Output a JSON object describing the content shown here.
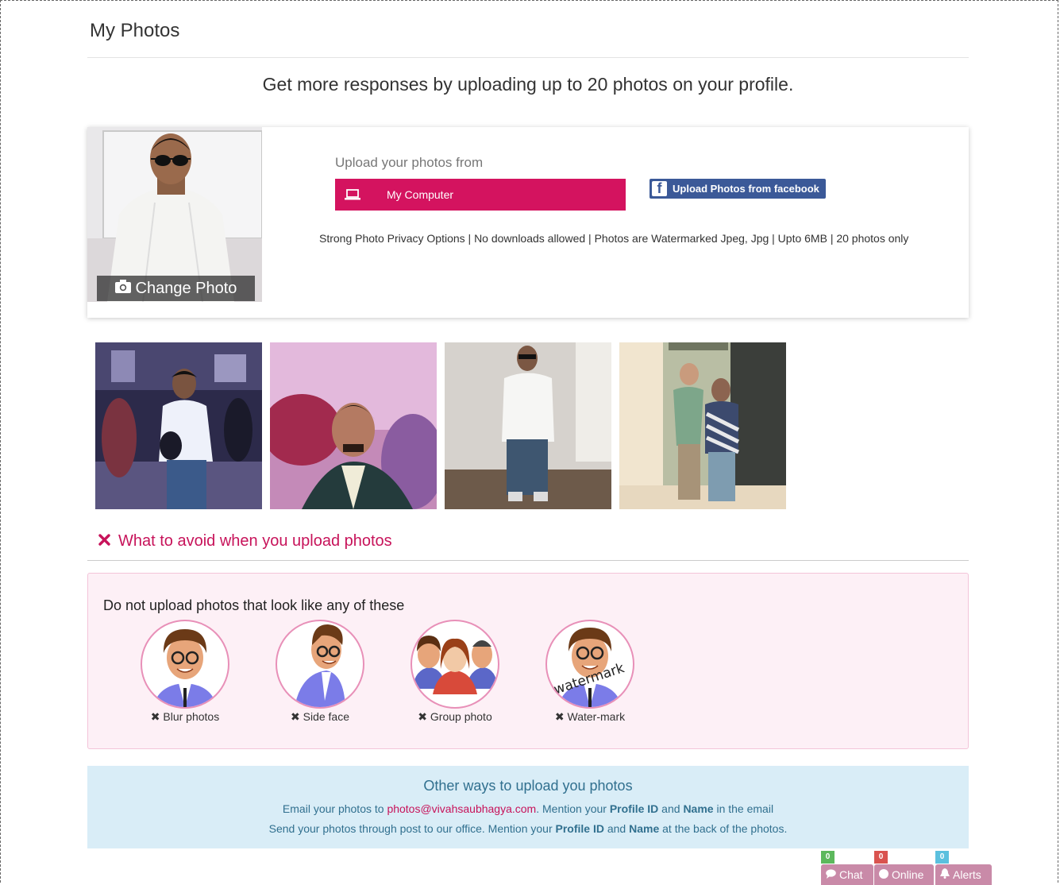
{
  "page": {
    "title": "My Photos",
    "headline": "Get more responses by uploading up to 20 photos on your profile."
  },
  "upload": {
    "change_photo_label": "Change Photo",
    "upload_from_label": "Upload your photos from",
    "computer_button": "My Computer",
    "facebook_button": "Upload Photos from facebook",
    "privacy_note": "Strong Photo Privacy Options | No downloads allowed | Photos are Watermarked Jpeg, Jpg | Upto 6MB | 20 photos only"
  },
  "gallery": {
    "count": 4
  },
  "avoid": {
    "heading": "What to avoid when you upload photos",
    "subheading": "Do not upload photos that look like any of these",
    "watermark_text": "watermark",
    "items": [
      {
        "label": "Blur photos"
      },
      {
        "label": "Side face"
      },
      {
        "label": "Group photo"
      },
      {
        "label": "Water-mark"
      }
    ]
  },
  "other_ways": {
    "title": "Other ways to upload you photos",
    "line1_prefix": "Email your photos to ",
    "email": "photos@vivahsaubhagya.com",
    "line1_mid": ". Mention your ",
    "profile_id": "Profile ID",
    "and": " and ",
    "name": "Name",
    "line1_suffix": " in the email",
    "line2_prefix": "Send your photos through post to our office. Mention your ",
    "line2_suffix": " at the back of the photos."
  },
  "footer": {
    "chat_label": "Chat",
    "chat_count": "0",
    "online_label": "Online",
    "online_count": "0",
    "alerts_label": "Alerts",
    "alerts_count": "0"
  },
  "colors": {
    "brand": "#d4135f",
    "facebook": "#3b5998",
    "info_bg": "#d9edf7",
    "info_text": "#31708f",
    "avoid_bg": "#fdf0f6"
  }
}
